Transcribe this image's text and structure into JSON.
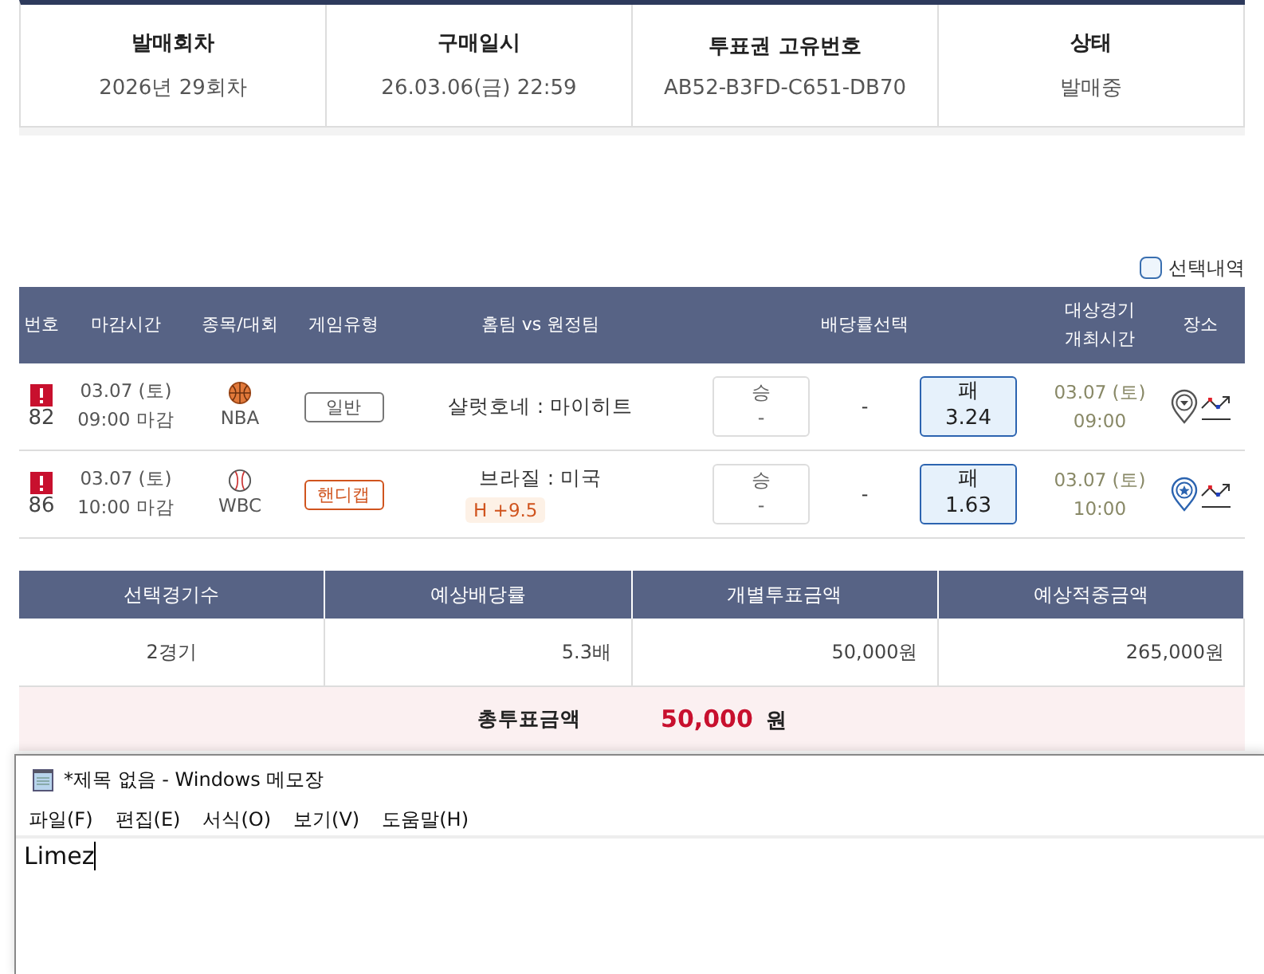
{
  "ticket_info": [
    {
      "label": "발매회차",
      "value": "2026년 29회차"
    },
    {
      "label": "구매일시",
      "value": "26.03.06(금) 22:59"
    },
    {
      "label": "투표권 고유번호",
      "value": "AB52-B3FD-C651-DB70"
    },
    {
      "label": "상태",
      "value": "발매중"
    }
  ],
  "selection_filter": {
    "label": "선택내역",
    "checked": false
  },
  "games_table": {
    "columns": [
      "번호",
      "마감시간",
      "종목/대회",
      "게임유형",
      "홈팀 vs 원정팀",
      "배당률선택",
      "대상경기\n개최시간",
      "장소"
    ],
    "rows": [
      {
        "warning": true,
        "number": "82",
        "deadline_date": "03.07 (토)",
        "deadline_time": "09:00 마감",
        "sport": {
          "kind": "basketball",
          "league": "NBA"
        },
        "game_type": {
          "kind": "general",
          "label": "일반"
        },
        "match": "샬럿호네 : 마이히트",
        "handicap": null,
        "odds": [
          {
            "kind": "button",
            "label": "승",
            "value": "-",
            "selected": false
          },
          {
            "kind": "plain",
            "value": "-"
          },
          {
            "kind": "button",
            "label": "패",
            "value": "3.24",
            "selected": true
          }
        ],
        "event_date": "03.07 (토)",
        "event_time": "09:00",
        "venue": {
          "kind": "away"
        }
      },
      {
        "warning": true,
        "number": "86",
        "deadline_date": "03.07 (토)",
        "deadline_time": "10:00 마감",
        "sport": {
          "kind": "baseball",
          "league": "WBC"
        },
        "game_type": {
          "kind": "handicap",
          "label": "핸디캡"
        },
        "match": "브라질 : 미국",
        "handicap": "H +9.5",
        "odds": [
          {
            "kind": "button",
            "label": "승",
            "value": "-",
            "selected": false
          },
          {
            "kind": "plain",
            "value": "-"
          },
          {
            "kind": "button",
            "label": "패",
            "value": "1.63",
            "selected": true
          }
        ],
        "event_date": "03.07 (토)",
        "event_time": "10:00",
        "venue": {
          "kind": "home"
        }
      }
    ]
  },
  "summary_table": {
    "columns": [
      "선택경기수",
      "예상배당률",
      "개별투표금액",
      "예상적중금액"
    ],
    "values": [
      "2경기",
      "5.3배",
      "50,000원",
      "265,000원"
    ],
    "total_label": "총투표금액",
    "total_amount": "50,000",
    "total_unit": "원"
  },
  "notepad": {
    "title": "*제목 없음 - Windows 메모장",
    "menu": [
      "파일(F)",
      "편집(E)",
      "서식(O)",
      "보기(V)",
      "도움말(H)"
    ],
    "text": "Limez"
  }
}
